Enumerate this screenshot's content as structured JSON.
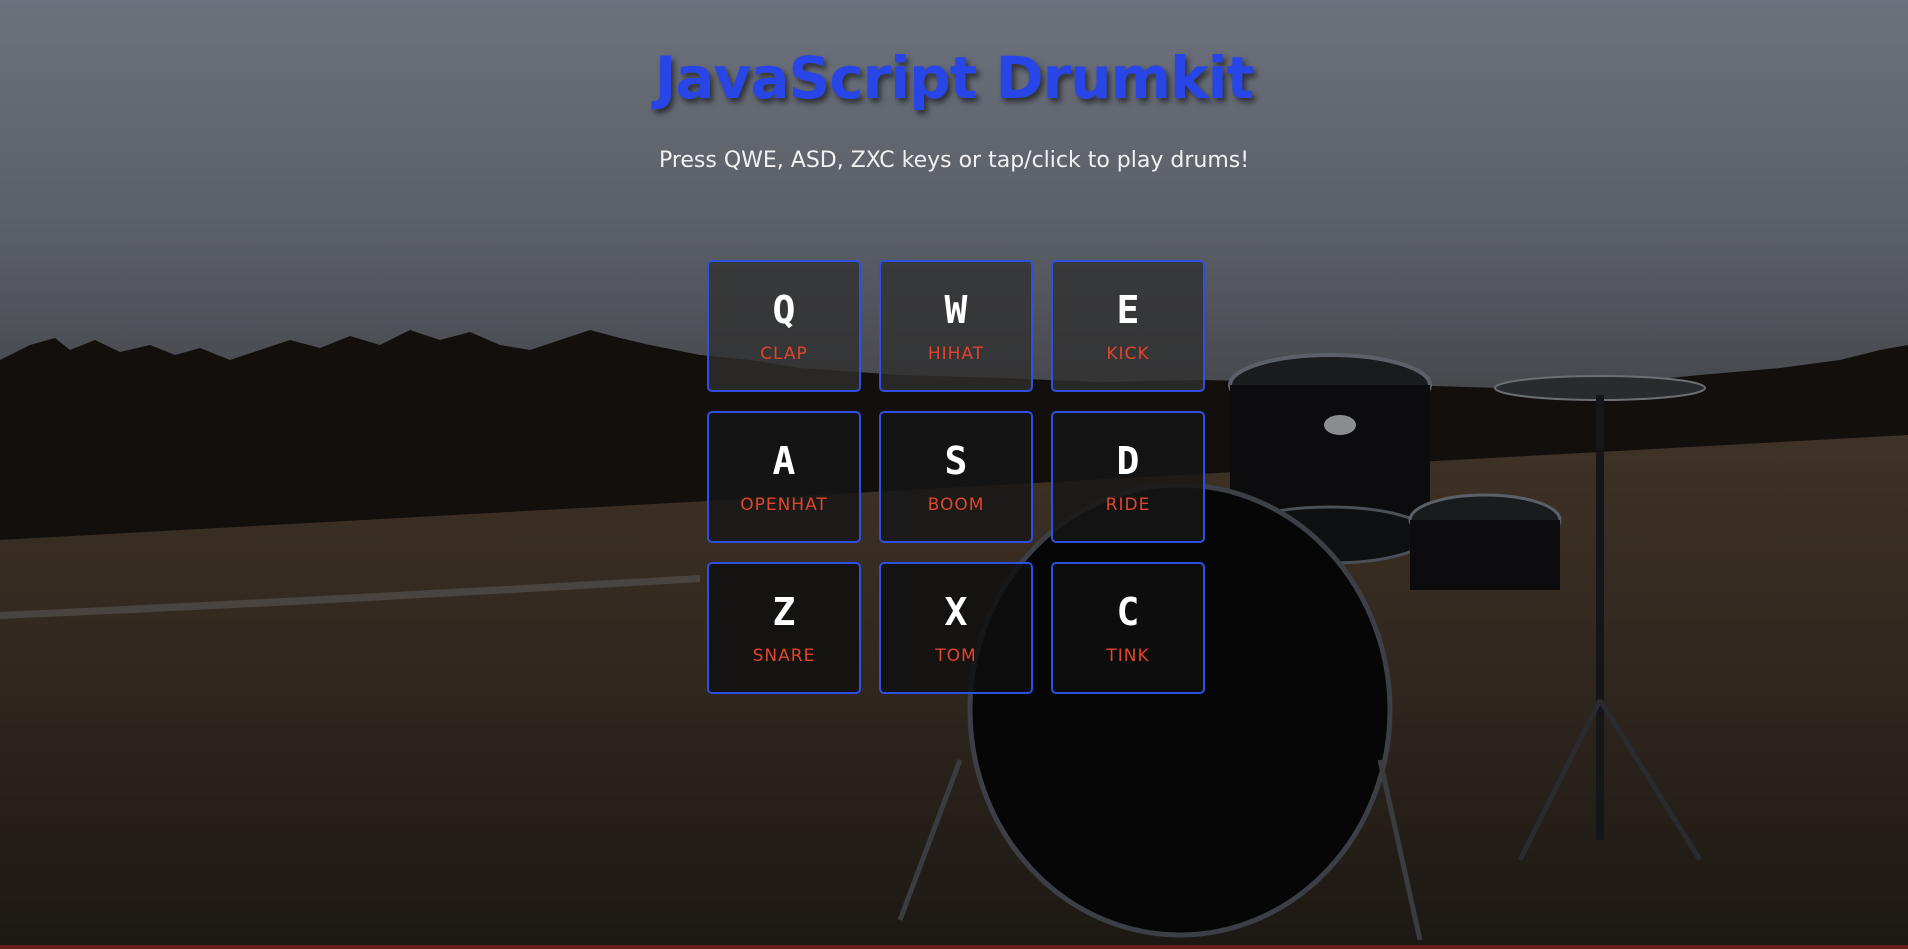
{
  "header": {
    "title": "JavaScript Drumkit",
    "subtitle": "Press QWE, ASD, ZXC keys or tap/click to play drums!"
  },
  "keys": [
    {
      "key": "Q",
      "sound": "CLAP"
    },
    {
      "key": "W",
      "sound": "HIHAT"
    },
    {
      "key": "E",
      "sound": "KICK"
    },
    {
      "key": "A",
      "sound": "OPENHAT"
    },
    {
      "key": "S",
      "sound": "BOOM"
    },
    {
      "key": "D",
      "sound": "RIDE"
    },
    {
      "key": "Z",
      "sound": "SNARE"
    },
    {
      "key": "X",
      "sound": "TOM"
    },
    {
      "key": "C",
      "sound": "TINK"
    }
  ],
  "colors": {
    "title": "#2846e8",
    "key_border": "#2f4fe0",
    "sound_label": "#e0452c",
    "key_letter": "#ffffff"
  },
  "background": {
    "description_icon": "drumkit-in-field-photo"
  }
}
